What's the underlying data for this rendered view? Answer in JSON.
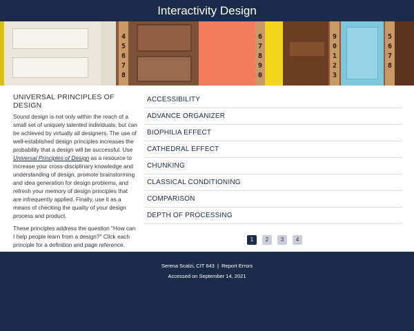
{
  "header": {
    "title": "Interactivity Design"
  },
  "banner": {
    "number_strips": [
      "4 5 6 7 8",
      "6 7 8 9 0",
      "9 0 1 2 3",
      "5 6 7 8"
    ]
  },
  "intro": {
    "heading": "UNIVERSAL PRINCIPLES OF DESIGN",
    "para1_a": "Sound design is not only within the reach of a small set of uniquely talented individuals, but can be achieved by virtually all designers. The use of well-established design principles increases the probability that a design will be successful. Use",
    "para1_link": "Universal Principles of Design",
    "para1_b": "as a resource to increase your cross-disciplinary knowledge and understanding of design, promote brainstorming and idea generation for design problems, and refresh your memory of design principles that are infrequently applied. Finally, use it as a means of checking the quality of your design process and product.",
    "para2": "These principles address the question \"How can I help people learn from a design?\" Click each principle for a definition and page reference."
  },
  "principles": [
    "ACCESSIBILITY",
    "ADVANCE ORGANIZER",
    "BIOPHILIA EFFECT",
    "CATHEDRAL EFFECT",
    "CHUNKING",
    "CLASSICAL CONDITIONING",
    "COMPARISON",
    "DEPTH OF PROCESSING"
  ],
  "pagination": {
    "pages": [
      "1",
      "2",
      "3",
      "4"
    ],
    "current": "1"
  },
  "footer": {
    "author": "Serena Scalzi, CIT 643",
    "separator": "|",
    "report_link": "Report Errors",
    "accessed": "Accessed on September 14, 2021"
  },
  "colors": {
    "navy": "#1c2b4a",
    "page_btn": "#c9ced9"
  }
}
